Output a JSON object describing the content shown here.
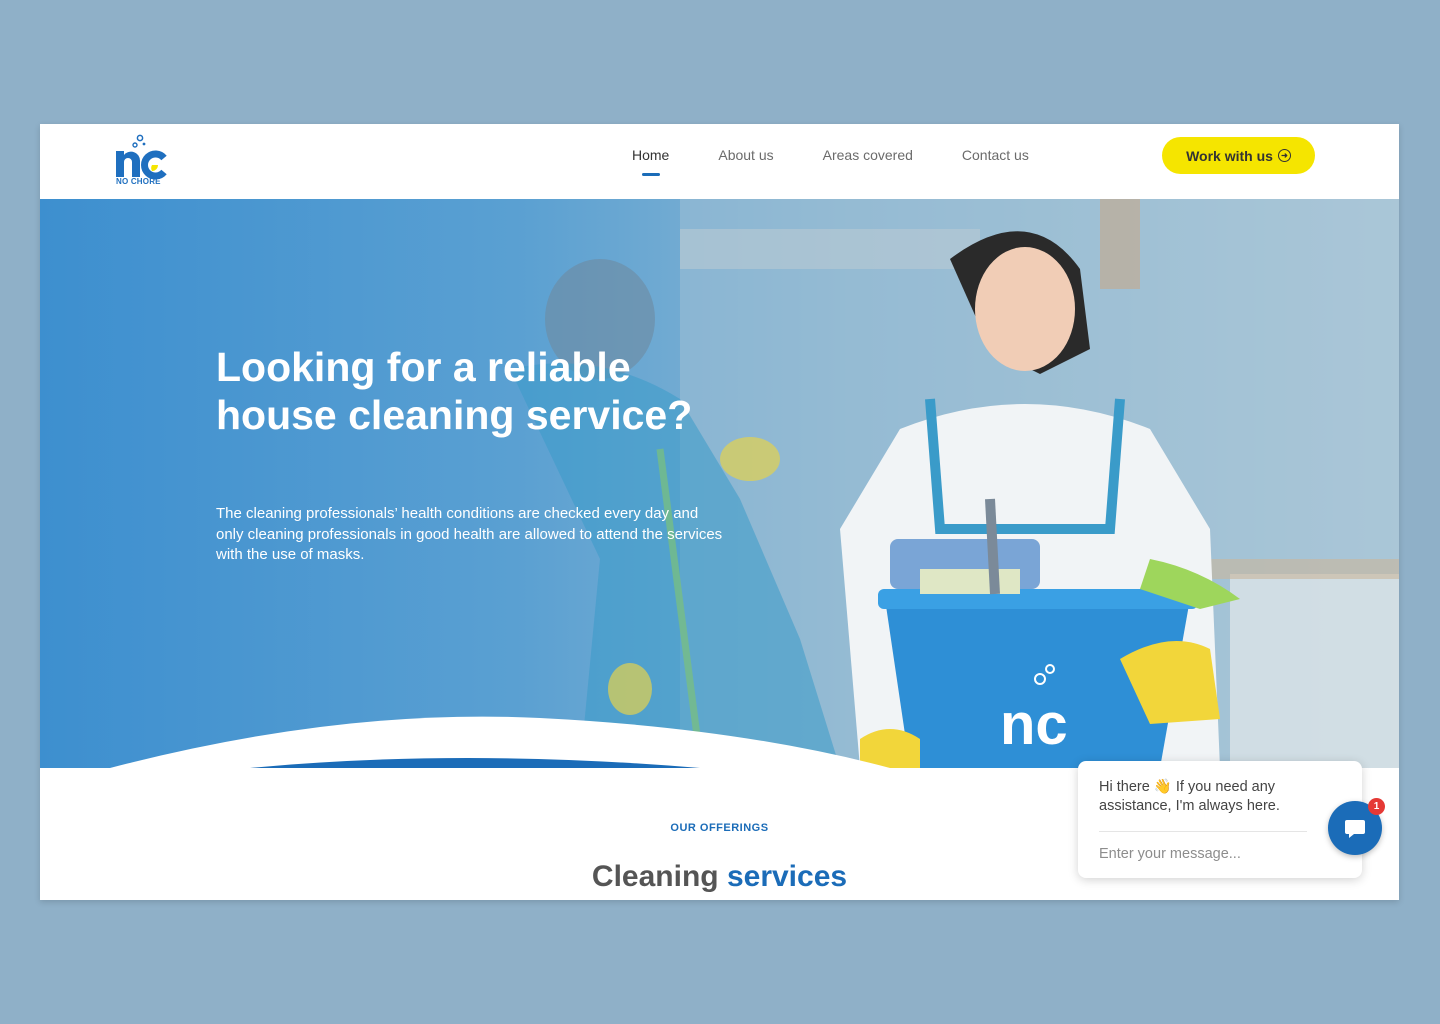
{
  "brand": {
    "name": "NO CHORE",
    "logo_letters": "nc",
    "primary_color": "#1b6cb8",
    "accent_color": "#f5e500"
  },
  "nav": {
    "items": [
      {
        "label": "Home",
        "active": true
      },
      {
        "label": "About us",
        "active": false
      },
      {
        "label": "Areas covered",
        "active": false
      },
      {
        "label": "Contact us",
        "active": false
      }
    ],
    "cta_label": "Work with us",
    "cta_icon": "arrow-right-circle-icon"
  },
  "hero": {
    "title": "Looking for a reliable house cleaning service?",
    "subtitle": "The cleaning professionals’ health conditions are checked every day and only cleaning professionals in good health are allowed to attend the services with the use of masks."
  },
  "offerings": {
    "eyebrow": "OUR OFFERINGS",
    "title_part1": "Cleaning",
    "title_part2": "services"
  },
  "chat": {
    "message": "Hi there 👋 If you need any assistance, I'm always here.",
    "input_placeholder": "Enter your message...",
    "unread_count": "1",
    "icon": "chat-bubble-icon"
  }
}
